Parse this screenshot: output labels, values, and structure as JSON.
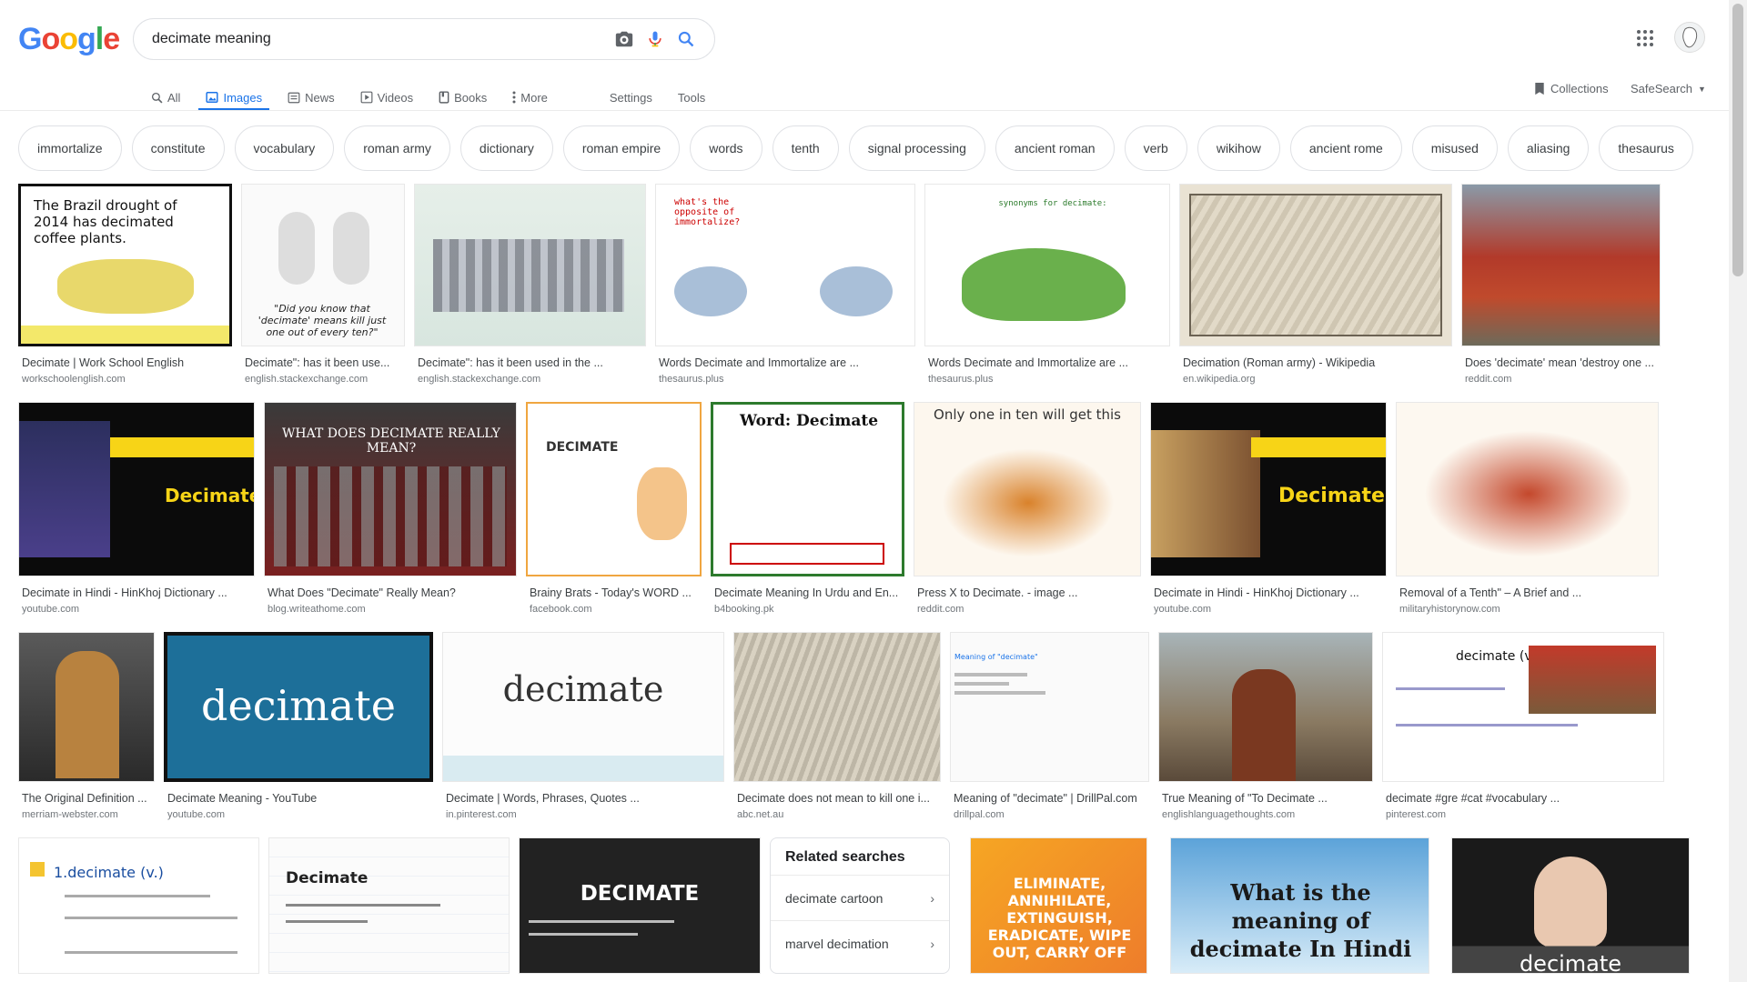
{
  "logo": {
    "g1": "G",
    "o1": "o",
    "o2": "o",
    "g2": "g",
    "l": "l",
    "e": "e"
  },
  "search": {
    "query": "decimate meaning",
    "placeholder": ""
  },
  "tabs": [
    {
      "label": "All",
      "icon": "search-icon"
    },
    {
      "label": "Images",
      "icon": "image-icon"
    },
    {
      "label": "News",
      "icon": "news-icon"
    },
    {
      "label": "Videos",
      "icon": "video-icon"
    },
    {
      "label": "Books",
      "icon": "book-icon"
    },
    {
      "label": "More",
      "icon": "more-vert-icon"
    }
  ],
  "tools": {
    "settings": "Settings",
    "tools": "Tools"
  },
  "header_right": {
    "collections": "Collections",
    "safesearch": "SafeSearch"
  },
  "chips": [
    "immortalize",
    "constitute",
    "vocabulary",
    "roman army",
    "dictionary",
    "roman empire",
    "words",
    "tenth",
    "signal processing",
    "ancient roman",
    "verb",
    "wikihow",
    "ancient rome",
    "misused",
    "aliasing",
    "thesaurus"
  ],
  "results": {
    "row1": [
      {
        "caption": "Decimate | Work School English",
        "source": "workschoolenglish.com",
        "thumb_text": "The Brazil drought of 2014 has decimated coffee plants."
      },
      {
        "caption": "Decimate\": has it been use...",
        "source": "english.stackexchange.com",
        "thumb_text": "\"Did you know that 'decimate' means kill just one out of every ten?\""
      },
      {
        "caption": "Decimate\": has it been used in the ...",
        "source": "english.stackexchange.com",
        "thumb_text": ""
      },
      {
        "caption": "Words Decimate and Immortalize are ...",
        "source": "thesaurus.plus",
        "thumb_text": "what's the opposite of immortalize?"
      },
      {
        "caption": "Words Decimate and Immortalize are ...",
        "source": "thesaurus.plus",
        "thumb_text": "synonyms for decimate:"
      },
      {
        "caption": "Decimation (Roman army) - Wikipedia",
        "source": "en.wikipedia.org",
        "thumb_text": ""
      },
      {
        "caption": "Does 'decimate' mean 'destroy one ...",
        "source": "reddit.com",
        "thumb_text": ""
      }
    ],
    "row2": [
      {
        "caption": "Decimate in Hindi - HinKhoj Dictionary ...",
        "source": "youtube.com",
        "thumb_text": "Decimate"
      },
      {
        "caption": "What Does \"Decimate\" Really Mean?",
        "source": "blog.writeathome.com",
        "thumb_text": "WHAT DOES DECIMATE REALLY MEAN?"
      },
      {
        "caption": "Brainy Brats - Today's WORD ...",
        "source": "facebook.com",
        "thumb_text": "DECIMATE"
      },
      {
        "caption": "Decimate Meaning In Urdu and En...",
        "source": "b4booking.pk",
        "thumb_text": "Word: Decimate"
      },
      {
        "caption": "Press X to Decimate. - image ...",
        "source": "reddit.com",
        "thumb_text": "Only one in ten will get this"
      },
      {
        "caption": "Decimate in Hindi - HinKhoj Dictionary ...",
        "source": "youtube.com",
        "thumb_text": "Decimate"
      },
      {
        "caption": "Removal of a Tenth\" – A Brief and ...",
        "source": "militaryhistorynow.com",
        "thumb_text": ""
      }
    ],
    "row3": [
      {
        "caption": "The Original Definition ...",
        "source": "merriam-webster.com",
        "thumb_text": ""
      },
      {
        "caption": "Decimate Meaning - YouTube",
        "source": "youtube.com",
        "thumb_text": "decimate"
      },
      {
        "caption": "Decimate | Words, Phrases, Quotes ...",
        "source": "in.pinterest.com",
        "thumb_text": "decimate"
      },
      {
        "caption": "Decimate does not mean to kill one i...",
        "source": "abc.net.au",
        "thumb_text": ""
      },
      {
        "caption": "Meaning of \"decimate\" | DrillPal.com",
        "source": "drillpal.com",
        "thumb_text": "Meaning of \"decimate\""
      },
      {
        "caption": "True Meaning of \"To Decimate ...",
        "source": "englishlanguagethoughts.com",
        "thumb_text": ""
      },
      {
        "caption": "decimate #gre #cat #vocabulary ...",
        "source": "pinterest.com",
        "thumb_text": "decimate (v)"
      }
    ],
    "row4": [
      {
        "thumb_text": "1.decimate (v.)"
      },
      {
        "thumb_text": "Decimate"
      },
      {
        "thumb_text": "DECIMATE"
      },
      {
        "thumb_text": "ELIMINATE, ANNIHILATE, EXTINGUISH, ERADICATE, WIPE OUT, CARRY OFF"
      },
      {
        "thumb_text": "What is the meaning of decimate In Hindi"
      },
      {
        "thumb_text": "decimate"
      }
    ]
  },
  "related": {
    "title": "Related searches",
    "items": [
      "decimate cartoon",
      "marvel decimation"
    ]
  },
  "colors": {
    "blue": "#4285F4",
    "red": "#EA4335",
    "yellow": "#FBBC05",
    "green": "#34A853",
    "active": "#1a73e8"
  }
}
